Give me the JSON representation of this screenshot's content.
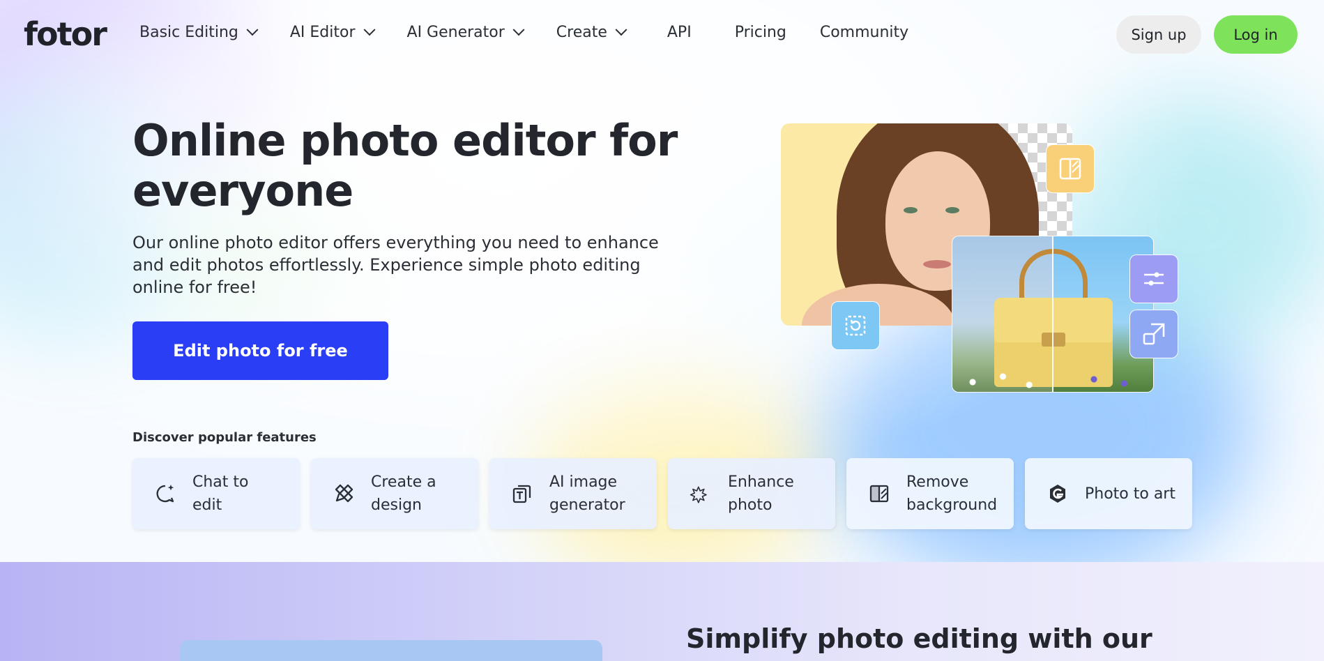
{
  "brand": {
    "logo_text": "fotor"
  },
  "nav": {
    "items": [
      {
        "label": "Basic Editing",
        "has_dropdown": true
      },
      {
        "label": "AI Editor",
        "has_dropdown": true
      },
      {
        "label": "AI Generator",
        "has_dropdown": true
      },
      {
        "label": "Create",
        "has_dropdown": true
      },
      {
        "label": "API",
        "has_dropdown": false
      },
      {
        "label": "Pricing",
        "has_dropdown": false
      },
      {
        "label": "Community",
        "has_dropdown": false
      }
    ],
    "signup_label": "Sign up",
    "login_label": "Log in"
  },
  "hero": {
    "title": "Online photo editor for everyone",
    "description": "Our online photo editor offers everything you need to enhance and edit photos effortlessly. Experience simple photo editing online for free!",
    "cta_label": "Edit photo for free"
  },
  "features": {
    "heading": "Discover popular features",
    "items": [
      {
        "label": "Chat to edit",
        "icon": "chat-sparkle-icon"
      },
      {
        "label": "Create a design",
        "icon": "pen-ruler-icon"
      },
      {
        "label": "AI image generator",
        "icon": "ai-image-icon"
      },
      {
        "label": "Enhance photo",
        "icon": "magic-wand-icon"
      },
      {
        "label": "Remove background",
        "icon": "remove-bg-icon"
      },
      {
        "label": "Photo to art",
        "icon": "photo-art-icon"
      }
    ]
  },
  "section2": {
    "title": "Simplify photo editing with our"
  },
  "colors": {
    "cta": "#2a3ff5",
    "login": "#7ee25a",
    "signup": "#ededed",
    "text": "#23262c"
  }
}
